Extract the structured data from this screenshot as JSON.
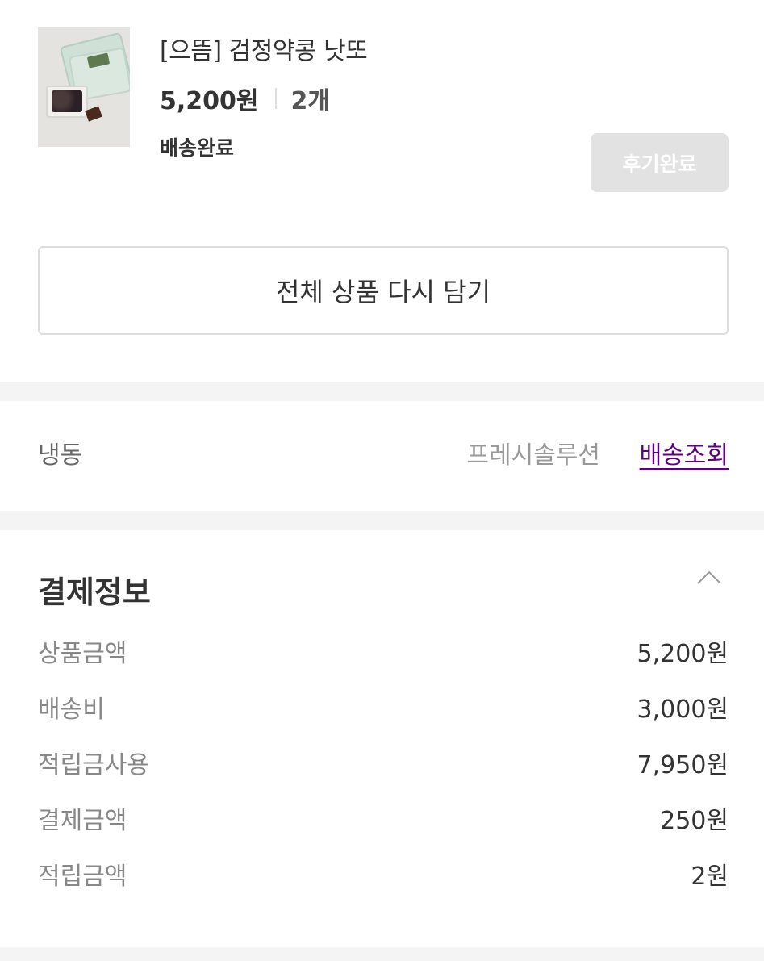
{
  "product": {
    "name": "[으뜸] 검정약콩 낫또",
    "price": "5,200원",
    "quantity": "2개",
    "status": "배송완료",
    "review_button": "후기완료"
  },
  "readd_button": "전체 상품 다시 담기",
  "delivery": {
    "type": "냉동",
    "carrier": "프레시솔루션",
    "track_link": "배송조회",
    "link_color": "#5f0080"
  },
  "payment": {
    "title": "결제정보",
    "toggle_icon": "chevron-up-icon",
    "rows": [
      {
        "label": "상품금액",
        "value": "5,200원"
      },
      {
        "label": "배송비",
        "value": "3,000원"
      },
      {
        "label": "적립금사용",
        "value": "7,950원"
      },
      {
        "label": "결제금액",
        "value": "250원"
      },
      {
        "label": "적립금액",
        "value": "2원"
      }
    ]
  }
}
